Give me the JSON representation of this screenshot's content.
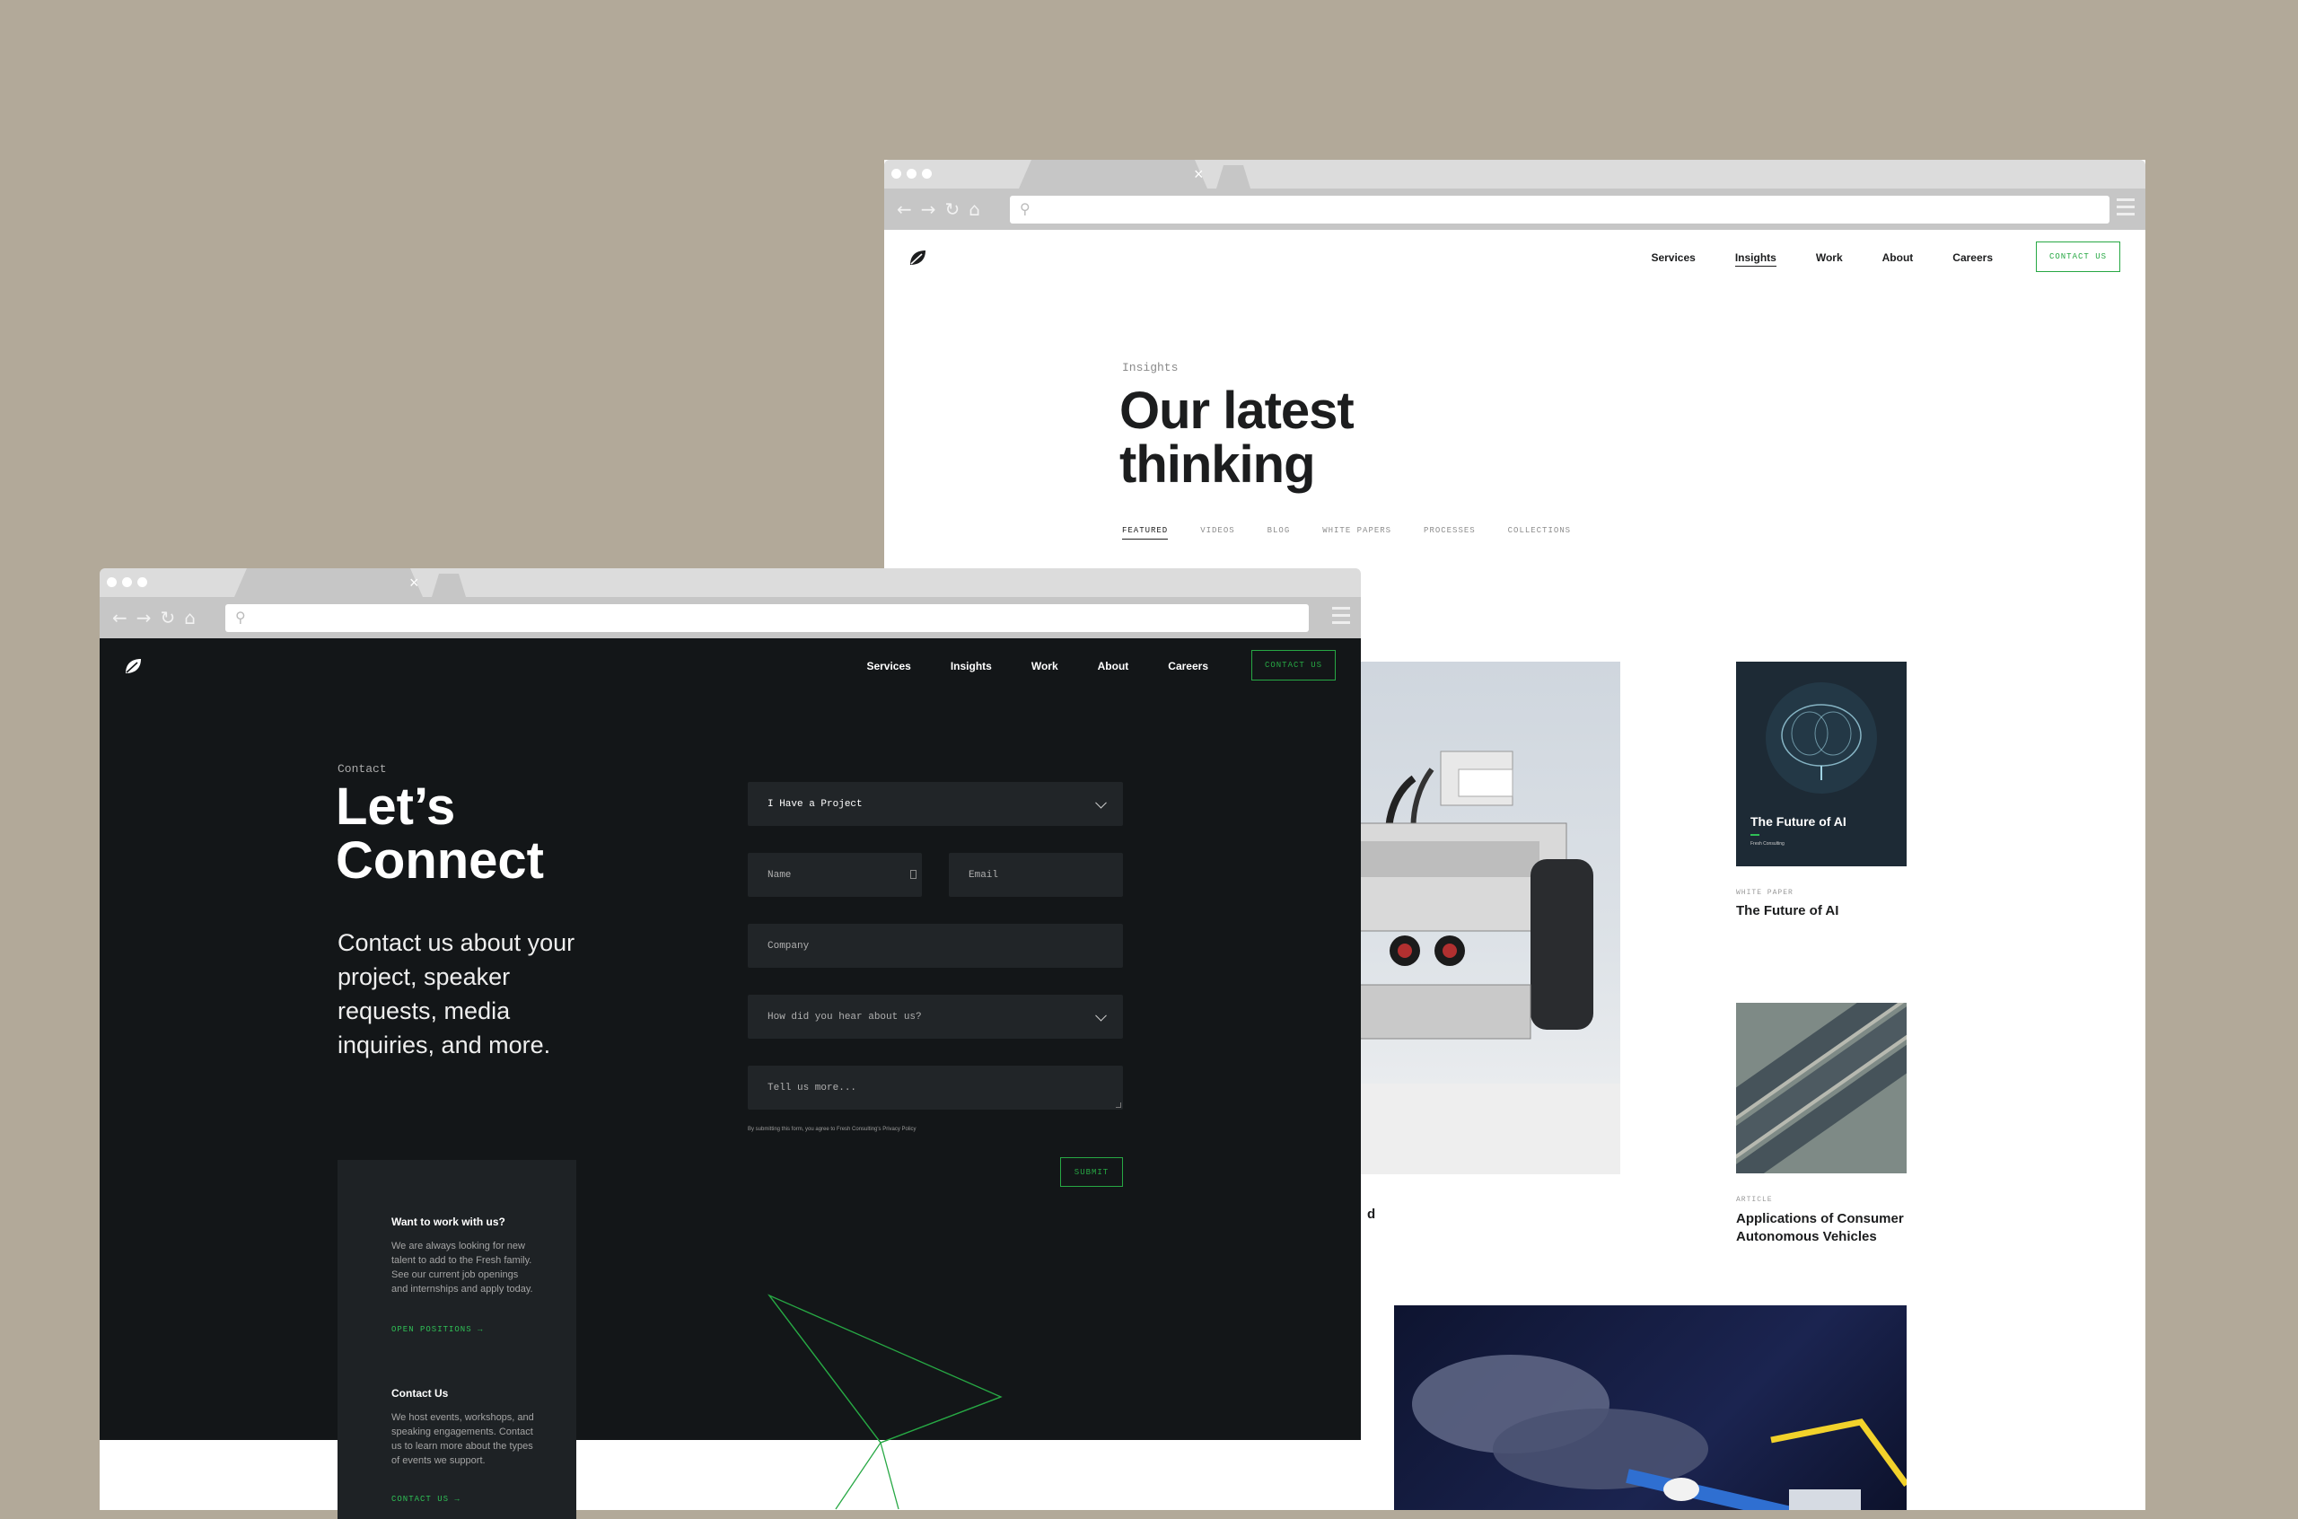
{
  "back_browser": {
    "nav": {
      "items": [
        "Services",
        "Insights",
        "Work",
        "About",
        "Careers"
      ],
      "active": "Insights",
      "cta": "CONTACT US"
    },
    "eyebrow": "Insights",
    "title": "Our latest thinking",
    "filters": [
      "FEATURED",
      "VIDEOS",
      "BLOG",
      "WHITE PAPERS",
      "PROCESSES",
      "COLLECTIONS"
    ],
    "active_filter": "FEATURED",
    "cards": [
      {
        "tag": "WHITE PAPER",
        "title": "The Future of AI",
        "cover_title": "The Future of AI",
        "cover_sub": "Fresh Consulting"
      },
      {
        "tag": "ARTICLE",
        "title": "Applications of Consumer Autonomous Vehicles"
      },
      {
        "title_fragment": "d"
      }
    ]
  },
  "front_browser": {
    "nav": {
      "items": [
        "Services",
        "Insights",
        "Work",
        "About",
        "Careers"
      ],
      "cta": "CONTACT US"
    },
    "eyebrow": "Contact",
    "title": "Let’s Connect",
    "description": "Contact us about your project, speaker requests, media inquiries, and more.",
    "form": {
      "inquiry_type": "I Have a Project",
      "name_placeholder": "Name",
      "email_placeholder": "Email",
      "company_placeholder": "Company",
      "source_placeholder": "How did you hear about us?",
      "message_placeholder": "Tell us more...",
      "fine_print": "By submitting this form, you agree to Fresh Consulting's Privacy Policy",
      "submit": "SUBMIT"
    },
    "side": {
      "work_title": "Want to work with us?",
      "work_text": "We are always looking for new talent to add to the Fresh family. See our current job openings and internships and apply today.",
      "work_link": "OPEN POSITIONS →",
      "contact_title": "Contact Us",
      "contact_text": "We host events, workshops, and speaking engagements. Contact us to learn more about the types of events we support.",
      "contact_link": "CONTACT US →"
    }
  },
  "colors": {
    "background": "#b2a999",
    "accent": "#27a844",
    "dark": "#131618"
  }
}
